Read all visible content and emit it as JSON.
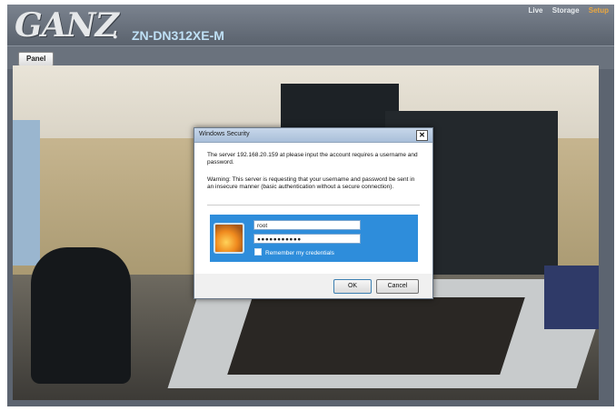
{
  "header": {
    "logo": "GANZ",
    "model": "ZN-DN312XE-M",
    "nav": [
      "Live",
      "Storage",
      "Setup"
    ]
  },
  "toolbar": {
    "panel_label": "Panel"
  },
  "dialog": {
    "title": "Windows Security",
    "close_glyph": "✕",
    "message": "The server 192.168.20.159 at please input the account requires a username and password.",
    "warning": "Warning: This server is requesting that your username and password be sent in an insecure manner (basic authentication without a secure connection).",
    "username_value": "root",
    "password_value": "●●●●●●●●●●●",
    "remember_label": "Remember my credentials",
    "ok_label": "OK",
    "cancel_label": "Cancel"
  },
  "icons": {
    "user_tile": "user-picture-icon",
    "close": "close-icon",
    "checkbox": "checkbox-icon"
  }
}
